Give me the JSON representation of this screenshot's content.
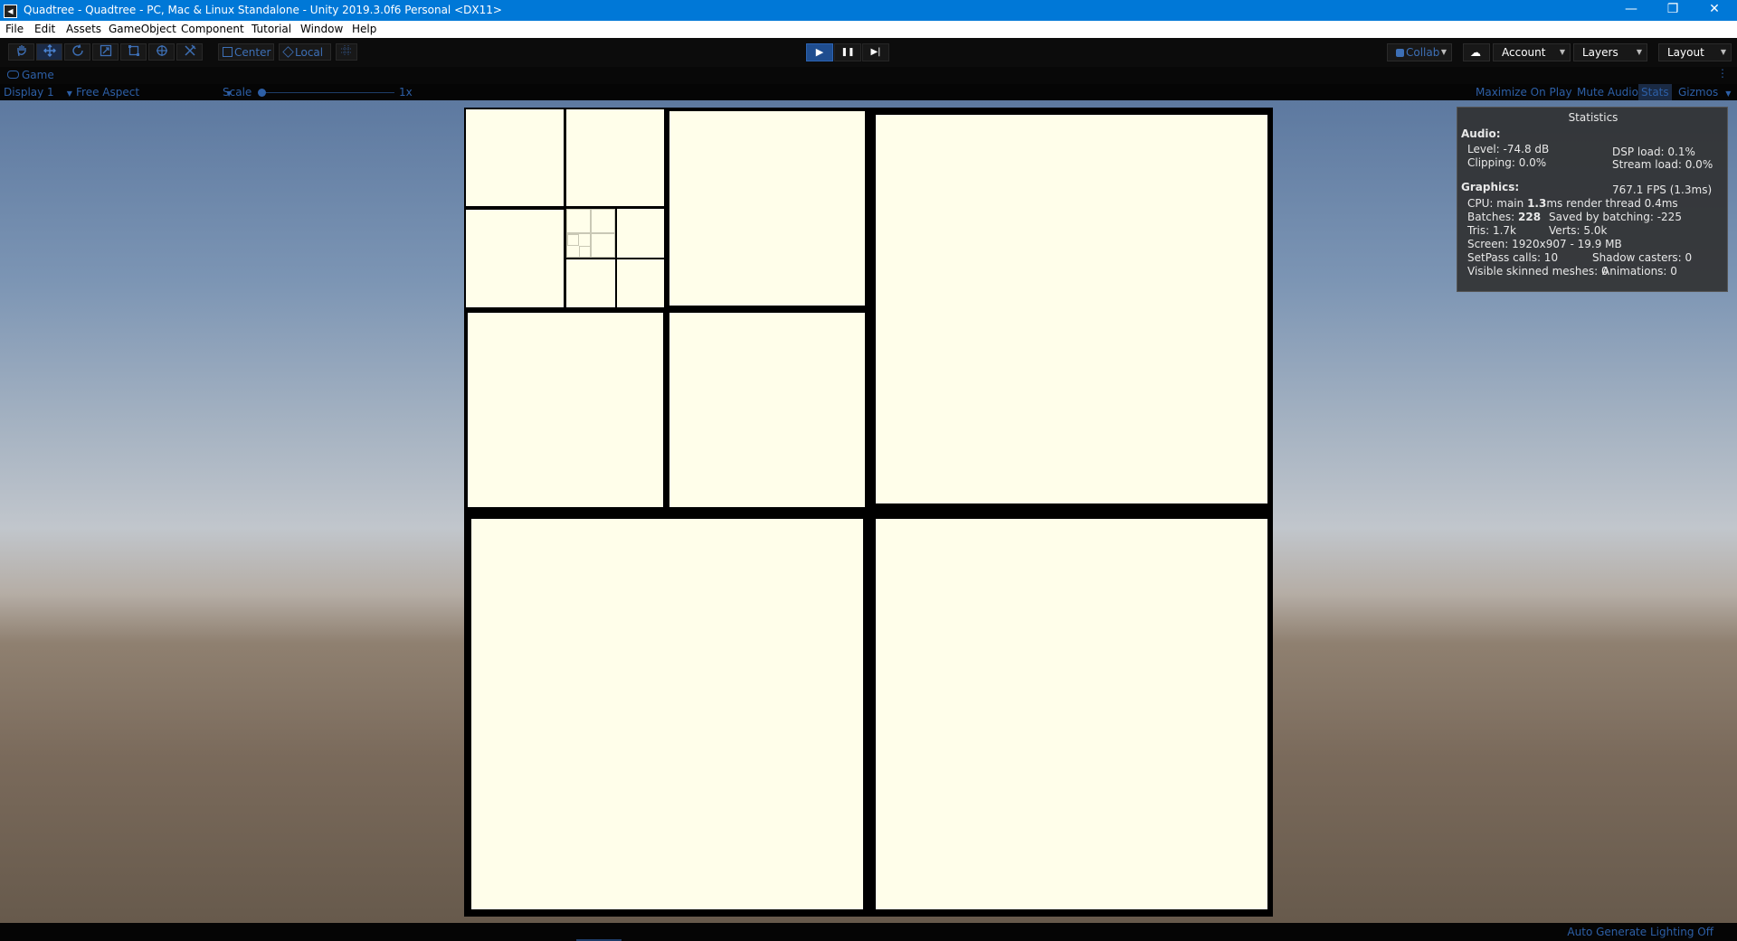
{
  "window": {
    "title": "Quadtree - Quadtree - PC, Mac & Linux Standalone - Unity 2019.3.0f6 Personal <DX11>",
    "icon_label": "◀",
    "minimize": "—",
    "restore": "❐",
    "close": "✕"
  },
  "menu": [
    "File",
    "Edit",
    "Assets",
    "GameObject",
    "Component",
    "Tutorial",
    "Window",
    "Help"
  ],
  "toolbar": {
    "tools": [
      "hand-tool-icon",
      "move-tool-icon",
      "rotate-tool-icon",
      "scale-tool-icon",
      "rect-tool-icon",
      "transform-tool-icon",
      "custom-tool-icon"
    ],
    "pivot_label": "Center",
    "space_label": "Local",
    "play": "▶",
    "pause": "❚❚",
    "step": "▶|",
    "collab": "Collab",
    "account": "Account",
    "layers": "Layers",
    "layout": "Layout"
  },
  "game_tab": {
    "label": "Game",
    "display": "Display 1",
    "aspect": "Free Aspect",
    "scale_label": "Scale",
    "scale_value": "1x",
    "maximize_on_play": "Maximize On Play",
    "mute_audio": "Mute Audio",
    "stats": "Stats",
    "gizmos": "Gizmos"
  },
  "statistics": {
    "title": "Statistics",
    "audio_header": "Audio:",
    "level": "Level: -74.8 dB",
    "clipping": "Clipping: 0.0%",
    "dsp_load": "DSP load: 0.1%",
    "stream_load": "Stream load: 0.0%",
    "graphics_header": "Graphics:",
    "fps": "767.1 FPS (1.3ms)",
    "cpu_prefix": "CPU: main ",
    "cpu_main": "1.3",
    "cpu_suffix": "ms  render thread 0.4ms",
    "batches_prefix": "Batches: ",
    "batches": "228",
    "saved_batching": "Saved by batching: -225",
    "tris": "Tris: 1.7k",
    "verts": "Verts: 5.0k",
    "screen": "Screen: 1920x907 - 19.9 MB",
    "setpass": "SetPass calls: 10",
    "shadow_casters": "Shadow casters: 0",
    "skinned": "Visible skinned meshes: 0",
    "animations": "Animations: 0"
  },
  "status": {
    "lighting": "Auto Generate Lighting Off"
  },
  "colors": {
    "titlebar": "#0078d7",
    "cell": "#fffeea",
    "accent_blue": "#2d5fa6"
  }
}
